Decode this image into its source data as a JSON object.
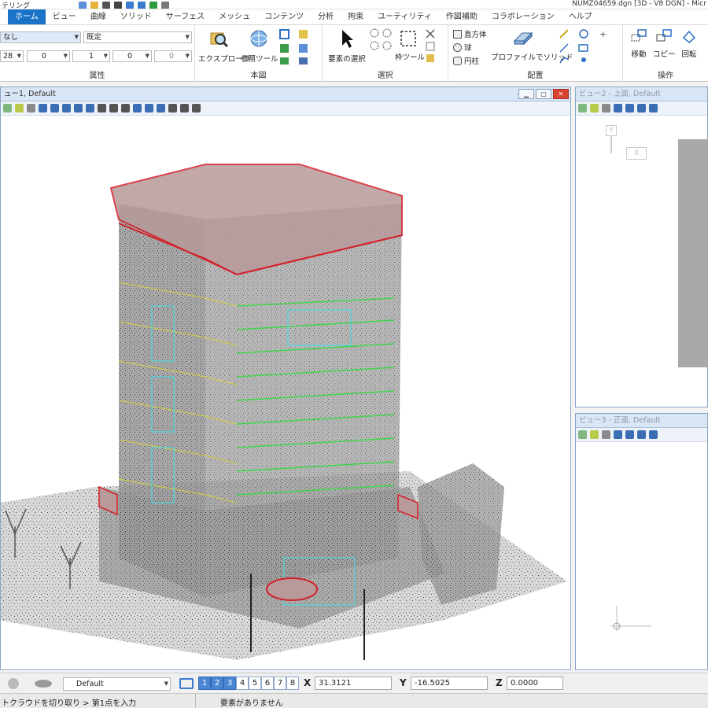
{
  "titlebar": {
    "qat_label": "テリング",
    "doc_title": "NUMZ04659.dgn [3D - V8 DGN] - Micr"
  },
  "tabs": [
    {
      "label": ""
    },
    {
      "label": "ホーム"
    },
    {
      "label": "ビュー"
    },
    {
      "label": "曲線"
    },
    {
      "label": "ソリッド"
    },
    {
      "label": "サーフェス"
    },
    {
      "label": "メッシュ"
    },
    {
      "label": "コンテンツ"
    },
    {
      "label": "分析"
    },
    {
      "label": "拘束"
    },
    {
      "label": "ユーティリティ"
    },
    {
      "label": "作図補助"
    },
    {
      "label": "コラボレーション"
    },
    {
      "label": "ヘルプ"
    }
  ],
  "ribbon": {
    "attributes": {
      "label": "属性",
      "level_value": "なし",
      "style_value": "既定",
      "color_value": "28",
      "linestyle_value": "0",
      "weight_value": "1",
      "transparency_value": "0",
      "priority_value": "0"
    },
    "primary": {
      "label": "本図",
      "explorer_label": "エクスプローラ",
      "reference_label": "参照ツール"
    },
    "selection": {
      "label": "選択",
      "element_select_label": "要素の選択",
      "fence_label": "枠ツール"
    },
    "placement": {
      "label": "配置",
      "cuboid_label": "直方体",
      "sphere_label": "球",
      "cylinder_label": "円柱",
      "profile_solid_label": "プロファイルでソリッド"
    },
    "manipulate": {
      "label": "操作",
      "move_label": "移動",
      "copy_label": "コピー",
      "rotate_label": "回転"
    }
  },
  "views": {
    "view1": {
      "title": "ュー1, Default"
    },
    "view2": {
      "title": "ビュー2 - 上面, Default"
    },
    "view3": {
      "title": "ビュー3 - 正面, Default"
    }
  },
  "axis_triad": {
    "y_label": "Y",
    "x_label": "X"
  },
  "bottombar": {
    "view_group_value": "Default",
    "view_numbers": [
      "1",
      "2",
      "3",
      "4",
      "5",
      "6",
      "7",
      "8"
    ],
    "x_label": "X",
    "x_value": "31.3121",
    "y_label": "Y",
    "y_value": "-16.5025",
    "z_label": "Z",
    "z_value": "0.0000"
  },
  "statusbar": {
    "prompt": "トクラウドを切り取り > 第1点を入力",
    "message": "要素がありません"
  },
  "colors": {
    "accent": "#1a73c8",
    "outline_red": "#d4202a",
    "outline_green": "#3fd64a",
    "outline_cyan": "#4fd6e0",
    "outline_yellow": "#d8d23a"
  }
}
